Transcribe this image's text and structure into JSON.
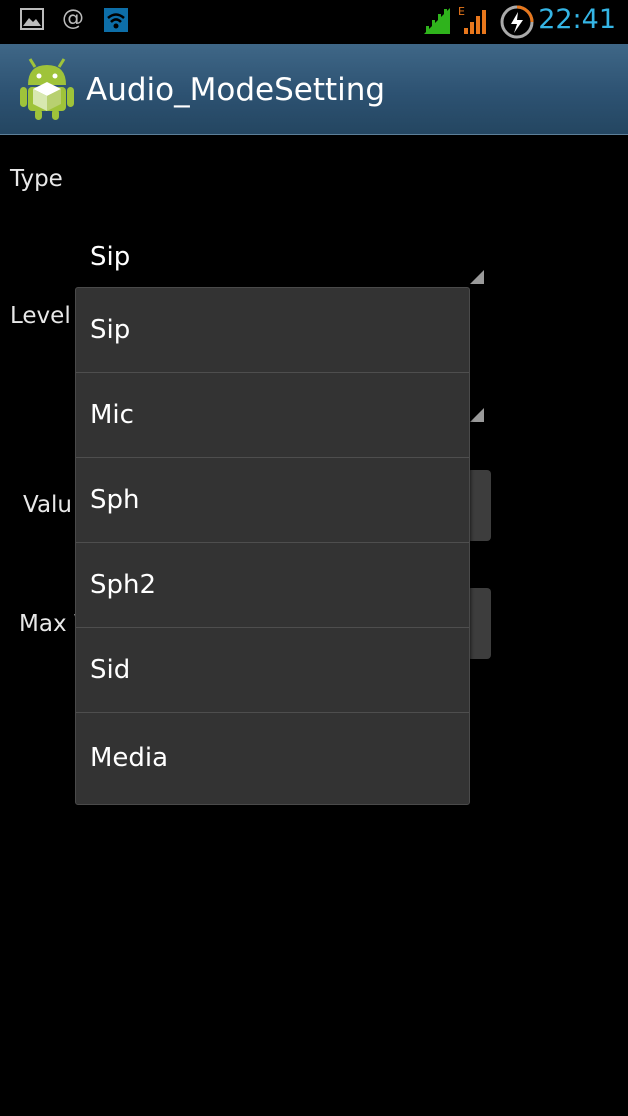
{
  "status_bar": {
    "time": "22:41",
    "icons": [
      "gallery-icon",
      "at-icon",
      "wifi-icon",
      "signal-icon",
      "signal-edge-icon",
      "battery-charging-icon"
    ],
    "network_type": "E",
    "colors": {
      "time": "#35b5e5",
      "signal": "#2fb31c",
      "edge_signal": "#e8771c"
    }
  },
  "action_bar": {
    "title": "Audio_ModeSetting",
    "icon": "android-app-icon"
  },
  "form": {
    "type_label": "Type",
    "type_value": "Sip",
    "level_label": "Level",
    "value_label": "Valu",
    "max_label": "Max V"
  },
  "dropdown": {
    "options": [
      "Sip",
      "Mic",
      "Sph",
      "Sph2",
      "Sid",
      "Media"
    ]
  }
}
